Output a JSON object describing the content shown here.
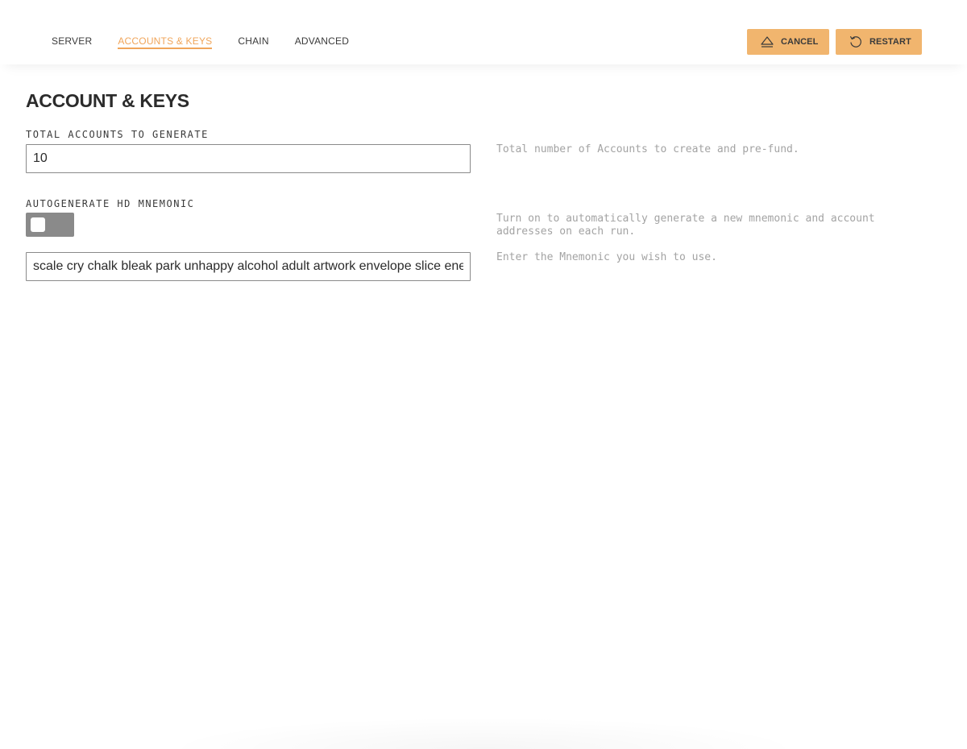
{
  "nav": {
    "tabs": [
      {
        "label": "SERVER",
        "active": false
      },
      {
        "label": "ACCOUNTS & KEYS",
        "active": true
      },
      {
        "label": "CHAIN",
        "active": false
      },
      {
        "label": "ADVANCED",
        "active": false
      }
    ]
  },
  "actions": {
    "cancel": {
      "label": "CANCEL",
      "icon": "eject-icon"
    },
    "restart": {
      "label": "RESTART",
      "icon": "restart-icon"
    }
  },
  "page": {
    "title": "ACCOUNT & KEYS"
  },
  "fields": {
    "total_accounts": {
      "label": "TOTAL ACCOUNTS TO GENERATE",
      "value": "10",
      "help": "Total number of Accounts to create and pre-fund."
    },
    "autogenerate": {
      "label": "AUTOGENERATE HD MNEMONIC",
      "enabled": false,
      "help": "Turn on to automatically generate a new mnemonic and account addresses on each run."
    },
    "mnemonic": {
      "value": "scale cry chalk bleak park unhappy alcohol adult artwork envelope slice energy",
      "help": "Enter the Mnemonic you wish to use."
    }
  },
  "colors": {
    "accent": "#f0a55a",
    "button_bg": "#f1b56e",
    "toggle_off": "#8a8a8a",
    "help_text": "#a3a3a3"
  }
}
